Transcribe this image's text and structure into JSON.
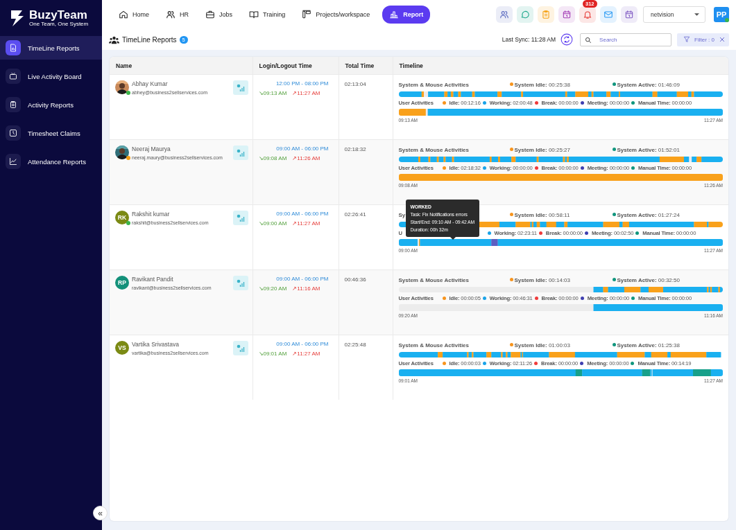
{
  "brand": {
    "name": "BuzyTeam",
    "tagline": "One Team, One System"
  },
  "sidebar": {
    "items": [
      {
        "label": "TimeLine Reports",
        "kind": "report",
        "selected": true
      },
      {
        "label": "Live Activity Board",
        "kind": "tv",
        "selected": false
      },
      {
        "label": "Activity Reports",
        "kind": "clipboard",
        "selected": false
      },
      {
        "label": "Timesheet Claims",
        "kind": "clock",
        "selected": false
      },
      {
        "label": "Attendance Reports",
        "kind": "chart",
        "selected": false
      }
    ],
    "collapse": "«"
  },
  "nav": [
    {
      "label": "Home",
      "kind": "home",
      "selected": false
    },
    {
      "label": "HR",
      "kind": "people",
      "selected": false
    },
    {
      "label": "Jobs",
      "kind": "briefcase",
      "selected": false
    },
    {
      "label": "Training",
      "kind": "book",
      "selected": false
    },
    {
      "label": "Projects/workspace",
      "kind": "projects",
      "selected": false
    },
    {
      "label": "Report",
      "kind": "bars",
      "selected": true
    }
  ],
  "toolbar": {
    "icons": [
      {
        "kind": "people"
      },
      {
        "kind": "chat"
      },
      {
        "kind": "clipboard"
      },
      {
        "kind": "calendar"
      },
      {
        "kind": "bell",
        "badge": "312"
      },
      {
        "kind": "mail"
      },
      {
        "kind": "calendar"
      }
    ],
    "org": "netvision",
    "user": "PP",
    "user_online": true
  },
  "page": {
    "title": "TimeLine Reports",
    "count": "5",
    "last_sync": "Last Sync: 11:28 AM",
    "search_placeholder": "Search",
    "filter": "Filter : 0"
  },
  "table": {
    "columns": [
      "Name",
      "Login/Logout Time",
      "Total Time",
      "Timeline"
    ],
    "rows": [
      {
        "name": "Abhay Kumar",
        "email": "abhey@business2sellservices.com",
        "kind": "picture",
        "status": {
          "color": "#3bb54a"
        },
        "shift": "12:00 PM - 08:00 PM",
        "login": "↘09:13 AM",
        "logout": "↗11:27 AM",
        "total": "02:13:04",
        "system": {
          "title": "System & Mouse Activities",
          "idle_label": "System Idle:",
          "idle": "00:25:38",
          "active_label": "System Active:",
          "active": "01:46:09"
        },
        "user": {
          "title": "User Activities",
          "stats": [
            {
              "kind": "idle",
              "label": "Idle:",
              "value": "00:12:16"
            },
            {
              "kind": "working",
              "label": "Working:",
              "value": "02:00:48"
            },
            {
              "kind": "break",
              "label": "Break:",
              "value": "00:00:00"
            },
            {
              "kind": "meeting",
              "label": "Meeting:",
              "value": "00:00:00"
            },
            {
              "kind": "manual",
              "label": "Manual Time:",
              "value": "00:00:00"
            }
          ],
          "start": "09:13 AM",
          "end": "11:27 AM"
        }
      },
      {
        "name": "Neeraj Maurya",
        "email": "neeraj.maury@business2sellservices.com",
        "kind": "picture",
        "status": {
          "color": "#f39c12"
        },
        "shift": "09:00 AM - 06:00 PM",
        "login": "↘09:08 AM",
        "logout": "↗11:26 AM",
        "total": "02:18:32",
        "system": {
          "title": "System & Mouse Activities",
          "idle_label": "System Idle:",
          "idle": "00:25:27",
          "active_label": "System Active:",
          "active": "01:52:01"
        },
        "user": {
          "title": "User Activities",
          "stats": [
            {
              "kind": "idle",
              "label": "Idle:",
              "value": "02:18:32"
            },
            {
              "kind": "working",
              "label": "Working:",
              "value": "00:00:00"
            },
            {
              "kind": "break",
              "label": "Break:",
              "value": "00:00:00"
            },
            {
              "kind": "meeting",
              "label": "Meeting:",
              "value": "00:00:00"
            },
            {
              "kind": "manual",
              "label": "Manual Time:",
              "value": "00:00:00"
            }
          ],
          "start": "09:08 AM",
          "end": "11:26 AM"
        }
      },
      {
        "name": "Rakshit kumar",
        "email": "rakshit@business2sellservices.com",
        "kind": "initials",
        "initials": "RK",
        "color": "#7b8a14",
        "status": {
          "color": "#3bb54a"
        },
        "shift": "09:00 AM - 06:00 PM",
        "login": "↘09:00 AM",
        "logout": "↗11:27 AM",
        "total": "02:26:41",
        "system": {
          "title": "Sy",
          "idle_label": "System Idle:",
          "idle": "00:58:11",
          "active_label": "System Active:",
          "active": "01:27:24"
        },
        "user": {
          "title": "U",
          "stats": [
            {
              "kind": "working",
              "label": "Working:",
              "value": "02:23:11"
            },
            {
              "kind": "break",
              "label": "Break:",
              "value": "00:00:00"
            },
            {
              "kind": "meeting",
              "label": "Meeting:",
              "value": "00:02:50"
            },
            {
              "kind": "manual",
              "label": "Manual Time:",
              "value": "00:00:00"
            }
          ],
          "start": "09:00 AM",
          "end": "11:27 AM"
        },
        "tooltip": {
          "title": "WORKED",
          "lines": [
            "Task: Fix Notifications errors",
            "Start/End: 09:10 AM - 09:42 AM",
            "Duration: 00h 32m"
          ]
        }
      },
      {
        "name": "Ravikant Pandit",
        "email": "ravikant@business2sellservices.com",
        "kind": "initials",
        "initials": "RP",
        "color": "#14917a",
        "shift": "09:00 AM - 06:00 PM",
        "login": "↘09:20 AM",
        "logout": "↗11:16 AM",
        "total": "00:46:36",
        "system": {
          "title": "System & Mouse Activities",
          "idle_label": "System Idle:",
          "idle": "00:14:03",
          "active_label": "System Active:",
          "active": "00:32:50"
        },
        "user": {
          "title": "User Activities",
          "stats": [
            {
              "kind": "idle",
              "label": "Idle:",
              "value": "00:00:05"
            },
            {
              "kind": "working",
              "label": "Working:",
              "value": "00:46:31"
            },
            {
              "kind": "break",
              "label": "Break:",
              "value": "00:00:00"
            },
            {
              "kind": "meeting",
              "label": "Meeting:",
              "value": "00:00:00"
            },
            {
              "kind": "manual",
              "label": "Manual Time:",
              "value": "00:00:00"
            }
          ],
          "start": "09:20 AM",
          "end": "11:16 AM"
        }
      },
      {
        "name": "Vartika Srivastava",
        "email": "vartika@business2sellservices.com",
        "kind": "initials",
        "initials": "VS",
        "color": "#7b8a14",
        "shift": "09:00 AM - 06:00 PM",
        "login": "↘09:01 AM",
        "logout": "↗11:27 AM",
        "total": "02:25:48",
        "system": {
          "title": "System & Mouse Activities",
          "idle_label": "System Idle:",
          "idle": "01:00:03",
          "active_label": "System Active:",
          "active": "01:25:38"
        },
        "user": {
          "title": "User Activities",
          "stats": [
            {
              "kind": "idle",
              "label": "Idle:",
              "value": "00:00:03"
            },
            {
              "kind": "working",
              "label": "Working:",
              "value": "02:11:26"
            },
            {
              "kind": "break",
              "label": "Break:",
              "value": "00:00:00"
            },
            {
              "kind": "meeting",
              "label": "Meeting:",
              "value": "00:00:00"
            },
            {
              "kind": "manual",
              "label": "Manual Time:",
              "value": "00:14:19"
            }
          ],
          "start": "09:01 AM",
          "end": "11:27 AM"
        }
      }
    ]
  }
}
